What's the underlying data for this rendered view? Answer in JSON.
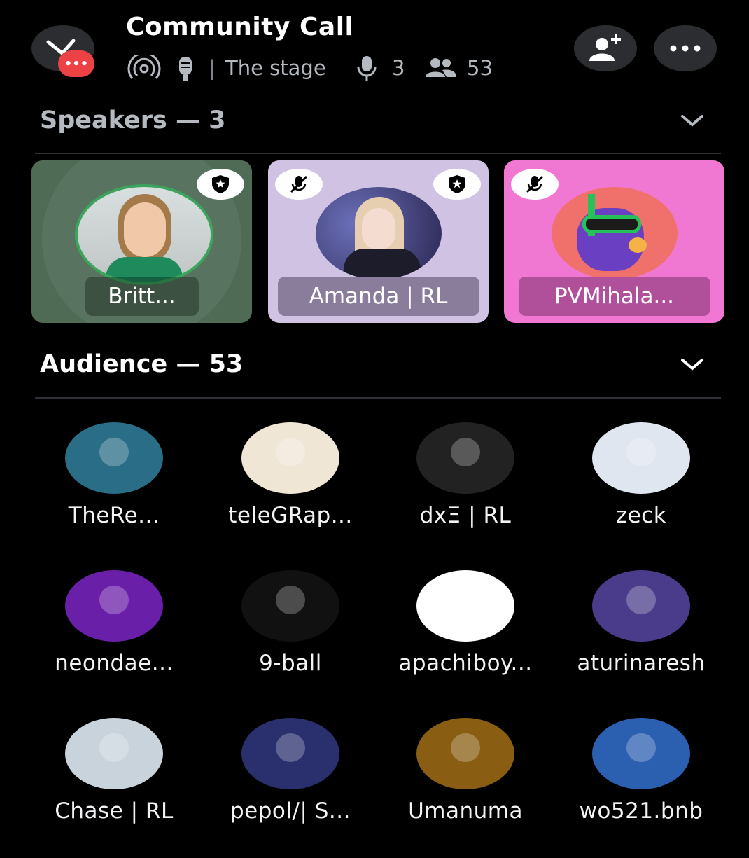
{
  "header": {
    "title": "Community Call",
    "stage_label": "The stage",
    "speaker_count": "3",
    "listener_count": "53",
    "icons": [
      "close-icon",
      "broadcast-icon",
      "microphone-stand-icon",
      "microphone-icon",
      "people-icon",
      "add-user-icon",
      "more-icon"
    ]
  },
  "speakers": {
    "title": "Speakers — 3",
    "items": [
      {
        "name": "Britt...",
        "color": "#4f6b55",
        "moderator": true,
        "muted": false
      },
      {
        "name": "Amanda | RL",
        "color": "#cfc2e3",
        "moderator": true,
        "muted": true
      },
      {
        "name": "PVMihala...",
        "color": "#f178d2",
        "moderator": false,
        "muted": true
      }
    ]
  },
  "audience": {
    "title": "Audience — 53",
    "items": [
      {
        "name": "TheRe...",
        "color": "#2a6d86"
      },
      {
        "name": "teleGRap...",
        "color": "#f0e6d6"
      },
      {
        "name": "dxΞ | RL",
        "color": "#222"
      },
      {
        "name": "zeck",
        "color": "#dfe6f0"
      },
      {
        "name": "neondae...",
        "color": "#6a1fa8"
      },
      {
        "name": "9-ball",
        "color": "#111"
      },
      {
        "name": "apachiboy...",
        "color": "#ffffff"
      },
      {
        "name": "aturinaresh",
        "color": "#4a3c8a"
      },
      {
        "name": "Chase | RL",
        "color": "#c9d3dc"
      },
      {
        "name": "pepol/| S...",
        "color": "#2a2f6e"
      },
      {
        "name": "Umanuma",
        "color": "#8a5e12"
      },
      {
        "name": "wo521.bnb",
        "color": "#2b5fb0"
      }
    ]
  },
  "colors": {
    "accent_red": "#ed4245",
    "speaking_ring": "#3ba55c",
    "background": "#000000"
  }
}
